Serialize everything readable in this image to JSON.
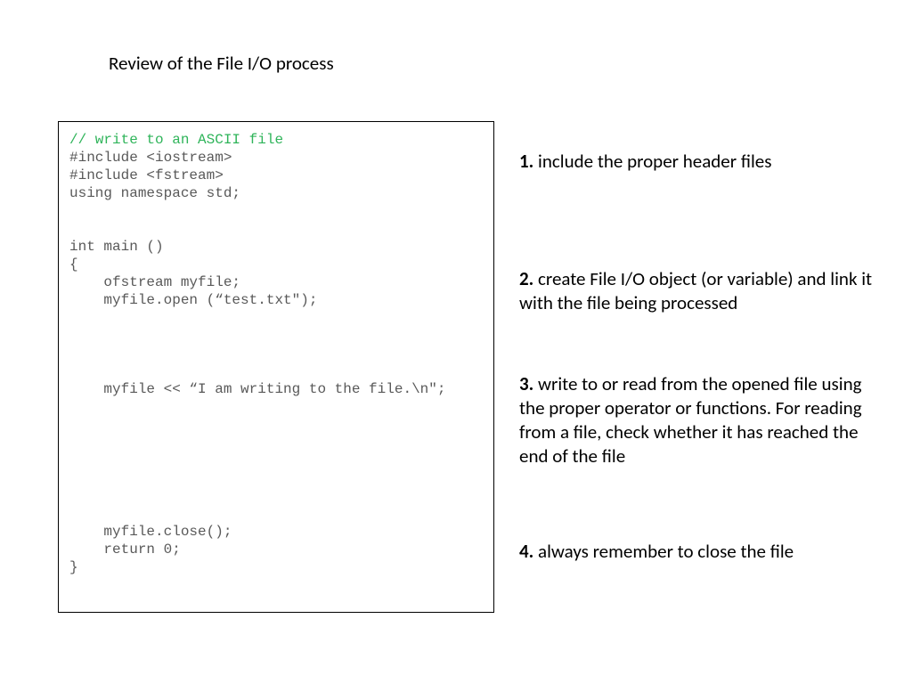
{
  "title": "Review of the File I/O process",
  "code": {
    "comment": "// write to an ASCII file",
    "block1": "#include <iostream>\n#include <fstream>\nusing namespace std;\n\n\nint main ()\n{\n    ofstream myfile;\n    myfile.open (“test.txt\");",
    "block2": "    myfile << “I am writing to the file.\\n\";",
    "block3": "    myfile.close();\n    return 0;\n}"
  },
  "steps": {
    "s1num": "1.",
    "s1text": " include the proper header files",
    "s2num": "2.",
    "s2text": " create File I/O object (or variable) and link it with the file being processed",
    "s3num": "3.",
    "s3text": " write to or read from the opened file using the proper operator or functions. For reading from a file, check whether it has reached the end of the file",
    "s4num": "4.",
    "s4text": " always remember to close the file"
  }
}
